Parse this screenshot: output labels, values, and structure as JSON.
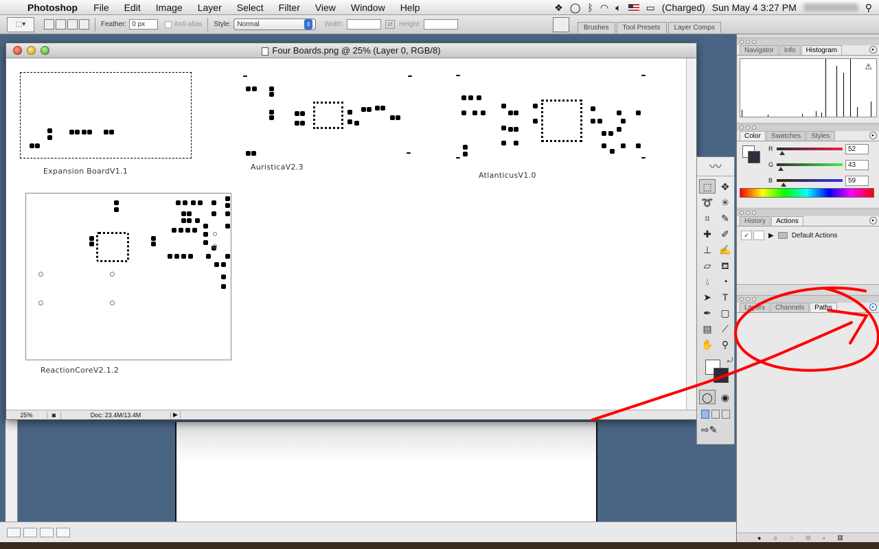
{
  "menubar": {
    "app_name": "Photoshop",
    "items": [
      "File",
      "Edit",
      "Image",
      "Layer",
      "Select",
      "Filter",
      "View",
      "Window",
      "Help"
    ],
    "battery_status": "(Charged)",
    "clock": "Sun May 4  3:27 PM"
  },
  "options": {
    "feather_label": "Feather:",
    "feather_value": "0 px",
    "antialias_label": "Anti-alias",
    "style_label": "Style:",
    "style_value": "Normal",
    "width_label": "Width:",
    "height_label": "Height:",
    "well_tabs": [
      "Brushes",
      "Tool Presets",
      "Layer Comps"
    ]
  },
  "document": {
    "title": "Four Boards.png @ 25% (Layer 0, RGB/8)",
    "zoom": "25%",
    "doc_info": "Doc: 23.4M/13.4M",
    "boards": [
      "Expansion BoardV1.1",
      "AuristicaV2.3",
      "AtlanticusV1.0",
      "ReactionCoreV2.1.2"
    ]
  },
  "panels": {
    "nav_tabs": [
      "Navigator",
      "Info",
      "Histogram"
    ],
    "color_tabs": [
      "Color",
      "Swatches",
      "Styles"
    ],
    "color": {
      "r_label": "R",
      "g_label": "G",
      "b_label": "B",
      "r": "52",
      "g": "43",
      "b": "59"
    },
    "history_tabs": [
      "History",
      "Actions"
    ],
    "default_actions": "Default Actions",
    "layers_tabs": [
      "Layers",
      "Channels",
      "Paths"
    ]
  },
  "colors": {
    "annotation": "#ff0000",
    "desktop": "#4a6584"
  }
}
